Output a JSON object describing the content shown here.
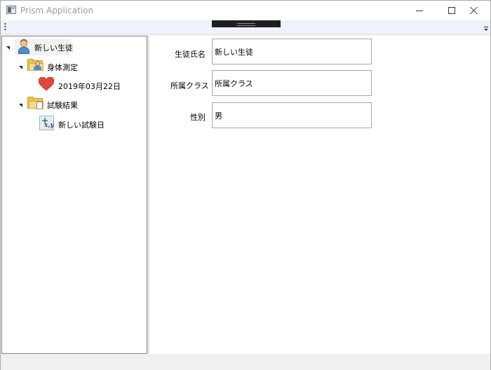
{
  "window": {
    "title": "Prism Application",
    "icons": {
      "app": "app-window-icon",
      "minimize": "minimize-icon",
      "maximize": "maximize-icon",
      "close": "close-icon"
    }
  },
  "toolbar": {
    "grip_icon": "toolbar-grip-icon",
    "overflow_icon": "overflow-chevron-icon"
  },
  "tree": {
    "root": {
      "label": "新しい生徒",
      "icon": "student-icon",
      "expanded": true,
      "selected": true
    },
    "body_measurement": {
      "label": "身体測定",
      "icon": "folder-person-icon",
      "expanded": true
    },
    "measurement_date": {
      "label": "2019年03月22日",
      "icon": "heart-icon"
    },
    "exam_results": {
      "label": "試験結果",
      "icon": "folder-document-icon",
      "expanded": true
    },
    "new_exam_date": {
      "label": "新しい試験日",
      "icon": "xy-formula-icon"
    }
  },
  "detail": {
    "name_label": "生徒氏名",
    "name_value": "新しい生徒",
    "class_label": "所属クラス",
    "class_value": "所属クラス",
    "gender_label": "性別",
    "gender_value": "男"
  },
  "colors": {
    "heart": "#e0483c",
    "folder": "#f0c64f",
    "border": "#a8a8a8"
  }
}
